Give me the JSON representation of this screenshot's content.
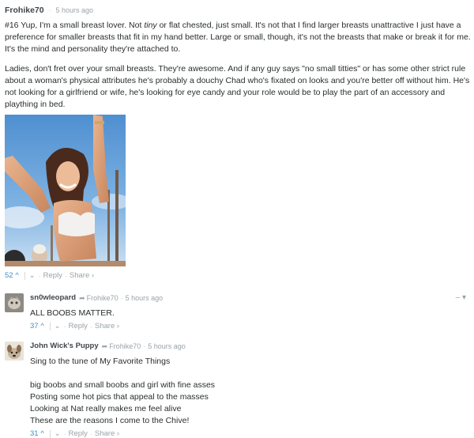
{
  "comment": {
    "author": "Frohike70",
    "time": "5 hours ago",
    "para1_pre": "#16 Yup, I'm a small breast lover. Not ",
    "para1_em": "tiny",
    "para1_post": " or flat chested, just small. It's not that I find larger breasts unattractive I just have a preference for smaller breasts that fit in my hand better. Large or small, though, it's not the breasts that make or break it for me. It's the mind and personality they're attached to.",
    "para2": "Ladies, don't fret over your small breasts. They're awesome. And if any guy says \"no small titties\" or has some other strict rule about a woman's physical attributes he's probably a douchy Chad who's fixated on looks and you're better off without him. He's not looking for a girlfriend or wife, he's looking for eye candy and your role would be to play the part of an accessory and plaything in bed.",
    "votes": "52",
    "reply_label": "Reply",
    "share_label": "Share ›"
  },
  "replies": [
    {
      "author": "sn0wleopard",
      "reply_to": "Frohike70",
      "time": "5 hours ago",
      "lines": [
        "ALL BOOBS MATTER."
      ],
      "votes": "37",
      "reply_label": "Reply",
      "share_label": "Share ›",
      "collapse": "– ▾"
    },
    {
      "author": "John Wick's Puppy",
      "reply_to": "Frohike70",
      "time": "5 hours ago",
      "lines": [
        "Sing to the tune of My Favorite Things",
        "",
        "big boobs and small boobs and girl with fine asses",
        "Posting some hot pics that appeal to the masses",
        "Looking at Nat really makes me feel alive",
        "These are the reasons I come to the Chive!"
      ],
      "votes": "31",
      "reply_label": "Reply",
      "share_label": "Share ›"
    }
  ],
  "icons": {
    "upvote": "chevron-up-icon",
    "downvote": "chevron-down-icon",
    "reply_arrow": "reply-arrow-icon"
  },
  "colors": {
    "accent": "#3f8fc9",
    "muted": "#9aa3a8",
    "text": "#2a2e2e"
  }
}
